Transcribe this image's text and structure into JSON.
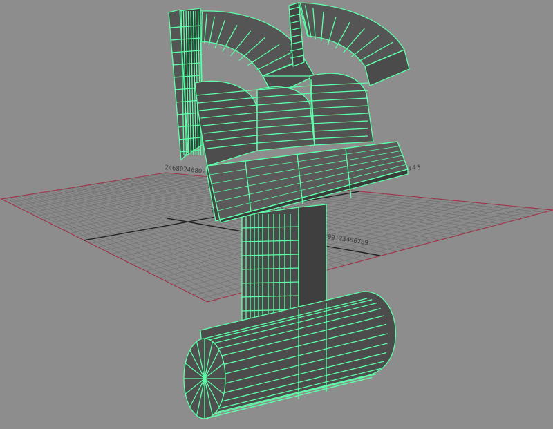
{
  "viewport": {
    "background_color": "#8d8d8d",
    "selection_wire_color": "#5dffa8",
    "surface_color": "#555555",
    "grid_color": "#6f6f6f",
    "grid_axis_color": "#222222",
    "grid_border_color": "#a0354a"
  },
  "grid_numbers": [
    "2468024680246890276543210",
    "123456789012345678901234567890123456789012345",
    "76543210",
    "0123456789",
    "567890123456789"
  ]
}
